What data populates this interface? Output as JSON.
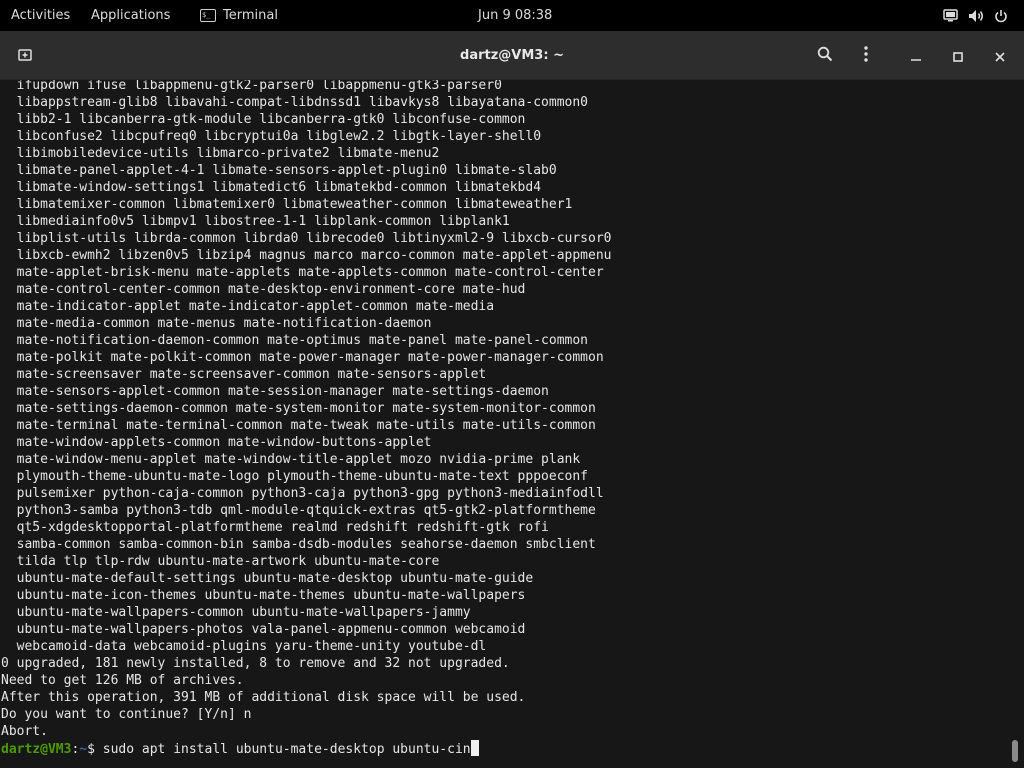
{
  "topbar": {
    "activities": "Activities",
    "applications": "Applications",
    "active_app": "Terminal",
    "clock": "Jun 9  08:38",
    "tray_icons": [
      "display-icon",
      "volume-icon",
      "power-icon"
    ]
  },
  "window": {
    "title": "dartz@VM3: ~",
    "buttons": [
      "new-tab-icon",
      "search-icon",
      "menu-icon",
      "minimize-icon",
      "maximize-icon",
      "close-icon"
    ]
  },
  "terminal": {
    "lines": [
      "  ifupdown ifuse libappmenu-gtk2-parser0 libappmenu-gtk3-parser0",
      "  libappstream-glib8 libavahi-compat-libdnssd1 libavkys8 libayatana-common0",
      "  libb2-1 libcanberra-gtk-module libcanberra-gtk0 libconfuse-common",
      "  libconfuse2 libcpufreq0 libcryptui0a libglew2.2 libgtk-layer-shell0",
      "  libimobiledevice-utils libmarco-private2 libmate-menu2",
      "  libmate-panel-applet-4-1 libmate-sensors-applet-plugin0 libmate-slab0",
      "  libmate-window-settings1 libmatedict6 libmatekbd-common libmatekbd4",
      "  libmatemixer-common libmatemixer0 libmateweather-common libmateweather1",
      "  libmediainfo0v5 libmpv1 libostree-1-1 libplank-common libplank1",
      "  libplist-utils librda-common librda0 librecode0 libtinyxml2-9 libxcb-cursor0",
      "  libxcb-ewmh2 libzen0v5 libzip4 magnus marco marco-common mate-applet-appmenu",
      "  mate-applet-brisk-menu mate-applets mate-applets-common mate-control-center",
      "  mate-control-center-common mate-desktop-environment-core mate-hud",
      "  mate-indicator-applet mate-indicator-applet-common mate-media",
      "  mate-media-common mate-menus mate-notification-daemon",
      "  mate-notification-daemon-common mate-optimus mate-panel mate-panel-common",
      "  mate-polkit mate-polkit-common mate-power-manager mate-power-manager-common",
      "  mate-screensaver mate-screensaver-common mate-sensors-applet",
      "  mate-sensors-applet-common mate-session-manager mate-settings-daemon",
      "  mate-settings-daemon-common mate-system-monitor mate-system-monitor-common",
      "  mate-terminal mate-terminal-common mate-tweak mate-utils mate-utils-common",
      "  mate-window-applets-common mate-window-buttons-applet",
      "  mate-window-menu-applet mate-window-title-applet mozo nvidia-prime plank",
      "  plymouth-theme-ubuntu-mate-logo plymouth-theme-ubuntu-mate-text pppoeconf",
      "  pulsemixer python-caja-common python3-caja python3-gpg python3-mediainfodll",
      "  python3-samba python3-tdb qml-module-qtquick-extras qt5-gtk2-platformtheme",
      "  qt5-xdgdesktopportal-platformtheme realmd redshift redshift-gtk rofi",
      "  samba-common samba-common-bin samba-dsdb-modules seahorse-daemon smbclient",
      "  tilda tlp tlp-rdw ubuntu-mate-artwork ubuntu-mate-core",
      "  ubuntu-mate-default-settings ubuntu-mate-desktop ubuntu-mate-guide",
      "  ubuntu-mate-icon-themes ubuntu-mate-themes ubuntu-mate-wallpapers",
      "  ubuntu-mate-wallpapers-common ubuntu-mate-wallpapers-jammy",
      "  ubuntu-mate-wallpapers-photos vala-panel-appmenu-common webcamoid",
      "  webcamoid-data webcamoid-plugins yaru-theme-unity youtube-dl",
      "0 upgraded, 181 newly installed, 8 to remove and 32 not upgraded.",
      "Need to get 126 MB of archives.",
      "After this operation, 391 MB of additional disk space will be used.",
      "Do you want to continue? [Y/n] n",
      "Abort."
    ],
    "prompt": {
      "user": "dartz@VM3",
      "sep": ":",
      "path": "~",
      "symbol": "$ ",
      "command": "sudo apt install ubuntu-mate-desktop ubuntu-cin"
    }
  }
}
